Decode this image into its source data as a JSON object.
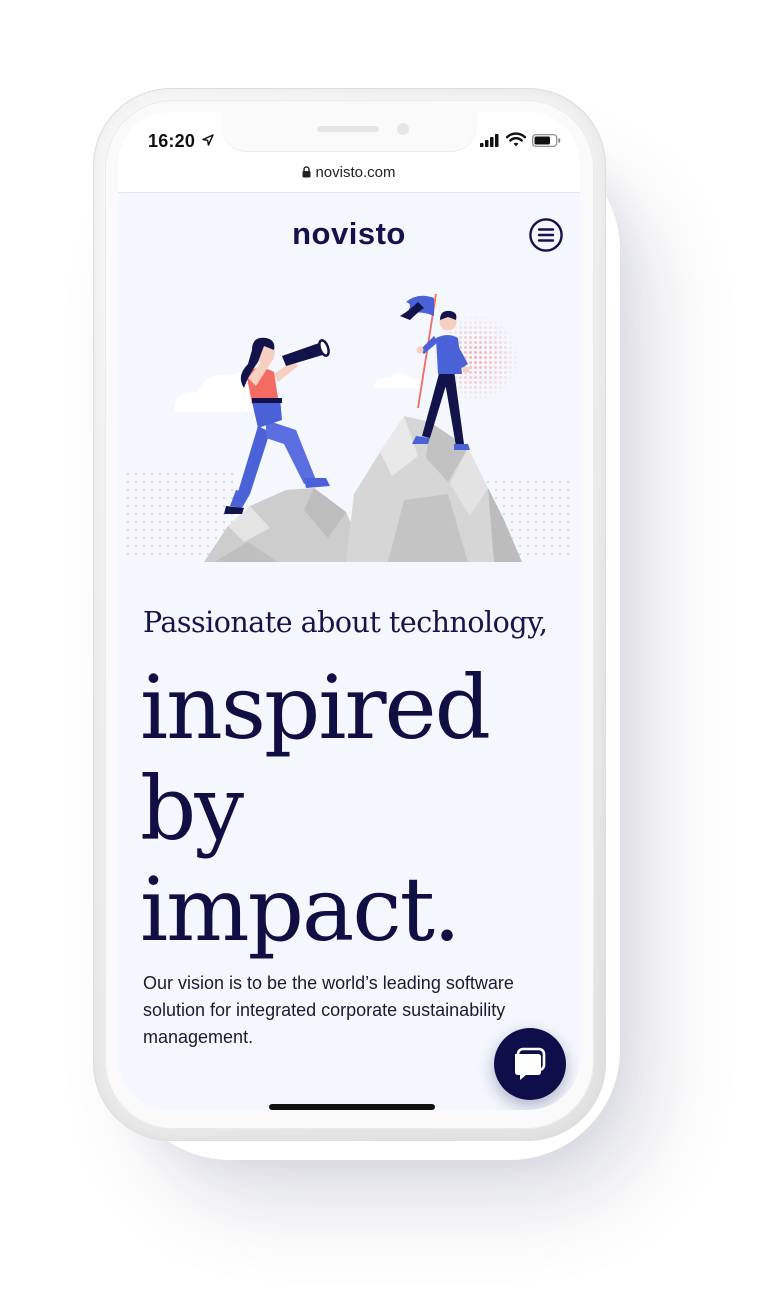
{
  "status_bar": {
    "time": "16:20",
    "location_icon": "location-arrow-icon",
    "signal_icon": "cellular-signal-icon",
    "wifi_icon": "wifi-icon",
    "battery_icon": "battery-icon"
  },
  "browser": {
    "url": "novisto.com",
    "lock_icon": "lock-icon"
  },
  "header": {
    "logo": "novisto",
    "menu_icon": "hamburger-menu-icon"
  },
  "hero": {
    "illustration": "explorers-on-mountain-illustration",
    "subheading": "Passionate about technology,",
    "headline_lines": [
      "inspired",
      "by",
      "impact."
    ],
    "description": "Our vision is to be the world’s leading software solution for integrated corporate sustainability management."
  },
  "chat": {
    "icon": "chat-bubble-icon"
  },
  "colors": {
    "brand_navy": "#0f0f44",
    "accent_coral": "#f36b62",
    "accent_blue": "#4b61d8",
    "page_background": "#f4f7fd"
  }
}
